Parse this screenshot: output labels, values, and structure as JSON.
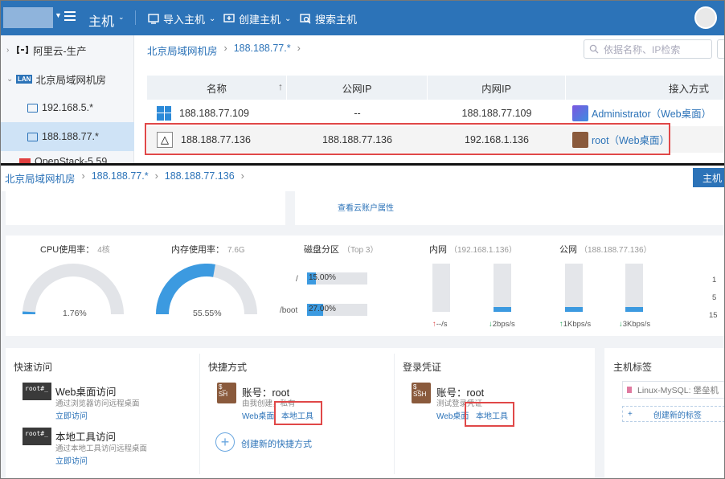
{
  "topnav": {
    "title": "主机",
    "import_host": "导入主机",
    "create_host": "创建主机",
    "search_host": "搜索主机"
  },
  "sidebar": {
    "items": [
      {
        "label": "阿里云-生产"
      },
      {
        "label": "北京局域网机房",
        "tag": "LAN"
      },
      {
        "label": "192.168.5.*"
      },
      {
        "label": "188.188.77.*"
      },
      {
        "label": "OpenStack-5.59"
      }
    ]
  },
  "breadcrumb_top": [
    "北京局域网机房",
    "188.188.77.*"
  ],
  "search": {
    "placeholder": "依据名称、IP检索"
  },
  "table": {
    "columns": [
      "名称",
      "公网IP",
      "内网IP",
      "接入方式"
    ],
    "sort_glyph": "↑",
    "rows": [
      {
        "name": "188.188.77.109",
        "public_ip": "--",
        "private_ip": "188.188.77.109",
        "access": "Administrator（Web桌面）",
        "os": "windows"
      },
      {
        "name": "188.188.77.136",
        "public_ip": "188.188.77.136",
        "private_ip": "192.168.1.136",
        "access": "root（Web桌面）",
        "os": "linux"
      }
    ]
  },
  "breadcrumb_bottom": [
    "北京局域网机房",
    "188.188.77.*",
    "188.188.77.136"
  ],
  "host_button": "主机",
  "account_link": "查看云账户属性",
  "stats": {
    "cpu": {
      "label": "CPU使用率：",
      "sub": "4核",
      "value": "1.76%",
      "fraction": 0.0176
    },
    "mem": {
      "label": "内存使用率：",
      "sub": "7.6G",
      "value": "55.55%",
      "fraction": 0.5555
    },
    "disk": {
      "label": "磁盘分区",
      "sub": "（Top 3）",
      "parts": [
        {
          "mount": "/",
          "pct": "15.00%",
          "fraction": 0.15
        },
        {
          "mount": "/boot",
          "pct": "27.00%",
          "fraction": 0.27
        }
      ]
    },
    "net_private": {
      "label": "内网",
      "sub": "（192.168.1.136）",
      "up": {
        "arrow": "↑",
        "value": "--/s",
        "fraction": 0.0
      },
      "down": {
        "arrow": "↓",
        "value": "2bps/s",
        "fraction": 0.1
      }
    },
    "net_public": {
      "label": "公网",
      "sub": "（188.188.77.136）",
      "up": {
        "arrow": "↑",
        "value": "1Kbps/s",
        "fraction": 0.1
      },
      "down": {
        "arrow": "↓",
        "value": "3Kbps/s",
        "fraction": 0.1
      }
    },
    "right_edge": [
      "1",
      "5",
      "15"
    ]
  },
  "quick_access": {
    "title": "快速访问",
    "items": [
      {
        "title": "Web桌面访问",
        "desc": "通过浏览器访问远程桌面",
        "link": "立即访问"
      },
      {
        "title": "本地工具访问",
        "desc": "通过本地工具访问远程桌面",
        "link": "立即访问"
      }
    ]
  },
  "shortcuts": {
    "title": "快捷方式",
    "account": "账号：root",
    "desc": "由我创建，私有",
    "web_link": "Web桌面",
    "local_link": "本地工具",
    "create": "创建新的快捷方式"
  },
  "credentials": {
    "title": "登录凭证",
    "account": "账号：root",
    "desc": "测试登录凭证",
    "web_link": "Web桌面",
    "local_link": "本地工具"
  },
  "host_tags": {
    "title": "主机标签",
    "tag": "Linux-MySQL: 堡垒机",
    "create": "创建新的标签"
  },
  "colors": {
    "primary": "#2c73b8",
    "highlight_row": "#f4f4f4",
    "active_sidebar": "#cfe3f6",
    "gauge_fill": "#3c9ae0",
    "annotation_red": "#e04848"
  }
}
